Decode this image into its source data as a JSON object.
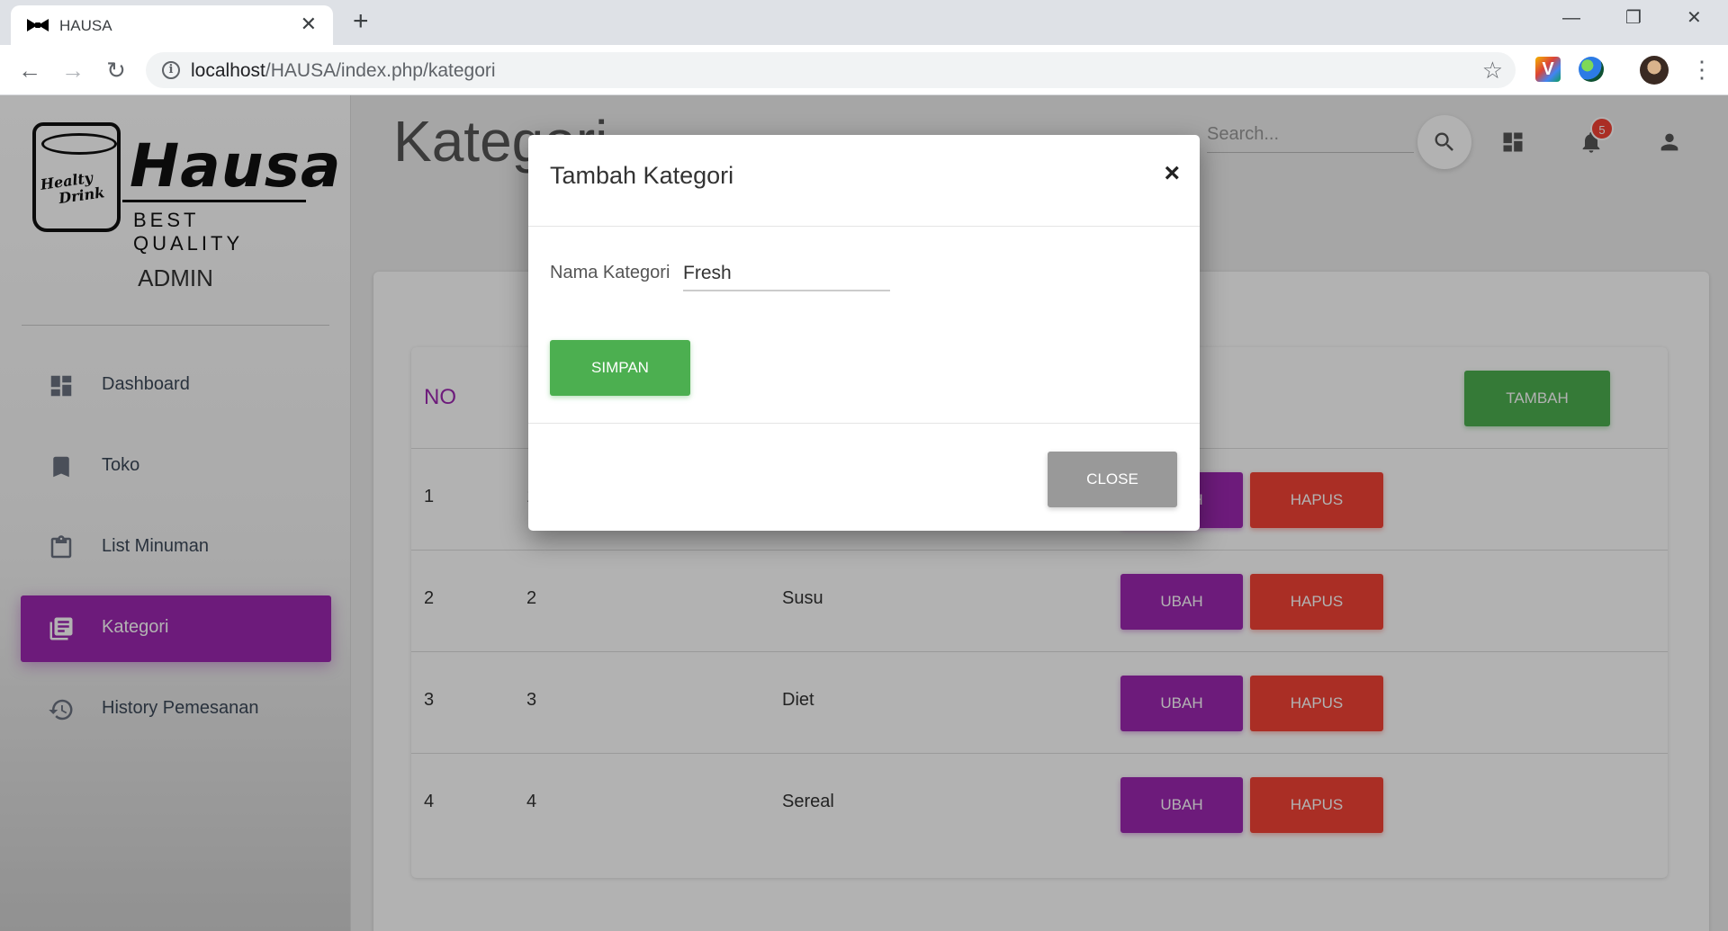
{
  "browser": {
    "tab_title": "HAUSA",
    "url_host": "localhost",
    "url_path": "/HAUSA/index.php/kategori"
  },
  "logo": {
    "cup_text_1": "Healty",
    "cup_text_2": "Drink",
    "brand": "Hausa",
    "tagline": "BEST QUALITY"
  },
  "sidebar": {
    "role": "ADMIN",
    "items": [
      {
        "label": "Dashboard",
        "icon": "dashboard-icon"
      },
      {
        "label": "Toko",
        "icon": "bookmark-icon"
      },
      {
        "label": "List Minuman",
        "icon": "clipboard-icon"
      },
      {
        "label": "Kategori",
        "icon": "library-books-icon",
        "active": true
      },
      {
        "label": "History Pemesanan",
        "icon": "history-icon"
      }
    ]
  },
  "header": {
    "page_title": "Kategori",
    "search_placeholder": "Search...",
    "notification_count": "5"
  },
  "table": {
    "col_no": "NO",
    "add_button": "TAMBAH",
    "rows": [
      {
        "no": "1",
        "id": "1",
        "name": ""
      },
      {
        "no": "2",
        "id": "2",
        "name": "Susu"
      },
      {
        "no": "3",
        "id": "3",
        "name": "Diet"
      },
      {
        "no": "4",
        "id": "4",
        "name": "Sereal"
      }
    ],
    "edit_label": "UBAH",
    "delete_label": "HAPUS"
  },
  "modal": {
    "title": "Tambah Kategori",
    "field_label": "Nama Kategori",
    "field_value": "Fresh",
    "save_label": "SIMPAN",
    "close_label": "CLOSE"
  },
  "colors": {
    "primary": "#9c27b0",
    "success": "#4caf50",
    "danger": "#f44336"
  }
}
